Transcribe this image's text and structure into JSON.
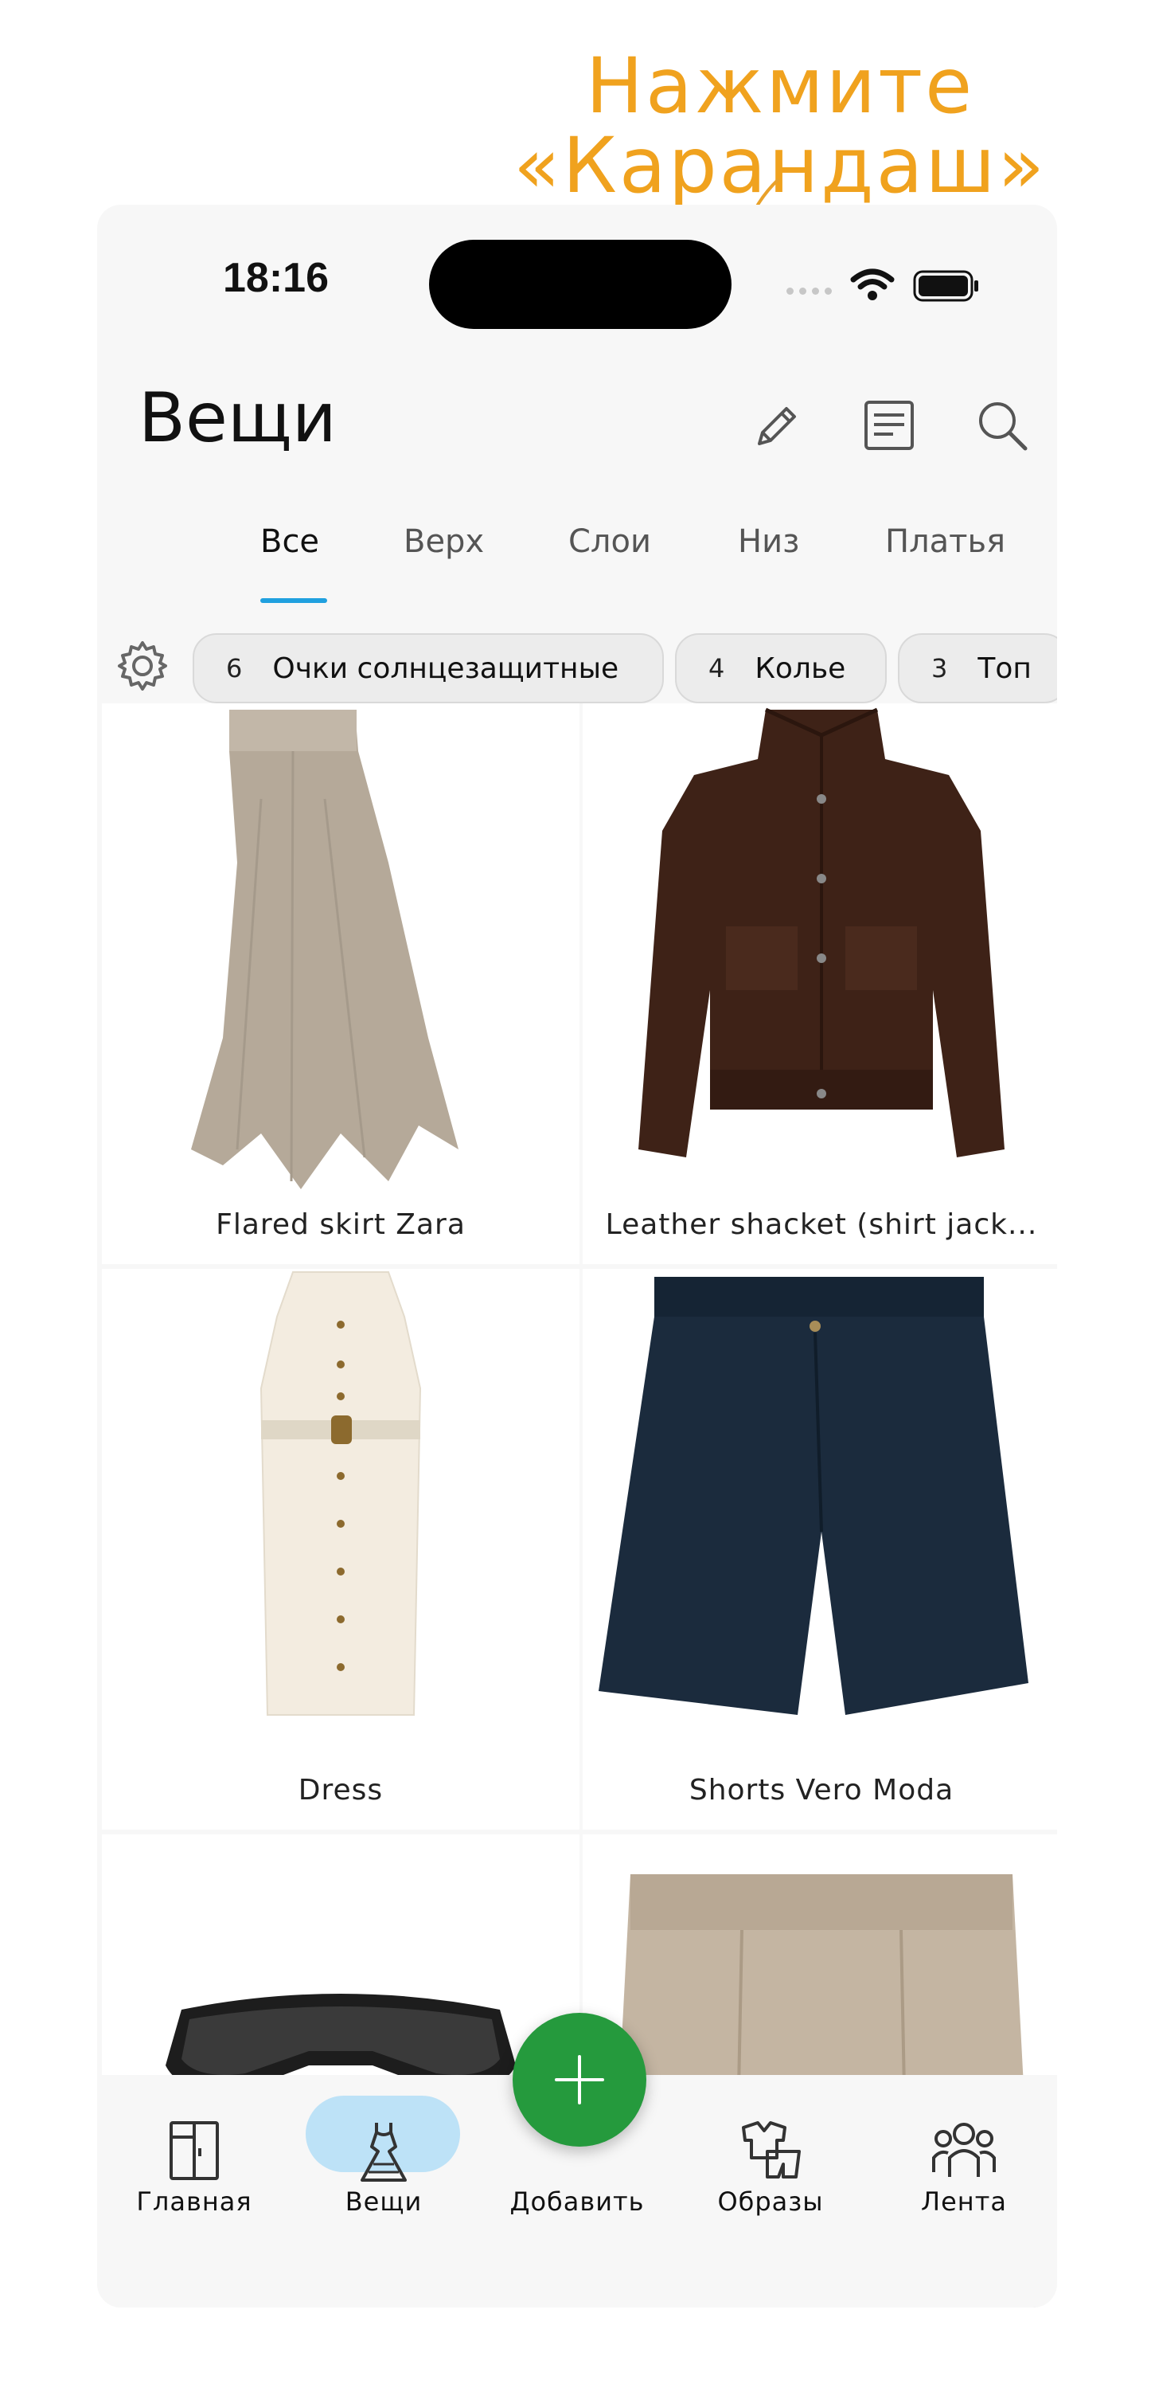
{
  "callout": {
    "line1": "Нажмите",
    "line2": "«Карандаш»"
  },
  "status_bar": {
    "time": "18:16"
  },
  "header": {
    "title": "Вещи",
    "icons": [
      "pencil-icon",
      "list-icon",
      "search-icon"
    ]
  },
  "tabs": [
    {
      "label": "Все",
      "active": true
    },
    {
      "label": "Верх",
      "active": false
    },
    {
      "label": "Слои",
      "active": false
    },
    {
      "label": "Низ",
      "active": false
    },
    {
      "label": "Платья",
      "active": false
    }
  ],
  "filter_chips": [
    {
      "count": "6",
      "label": "Очки солнцезащитные"
    },
    {
      "count": "4",
      "label": "Колье"
    },
    {
      "count": "3",
      "label": "Топ"
    }
  ],
  "items": [
    {
      "caption": "Flared skirt Zara"
    },
    {
      "caption": "Leather shacket (shirt jack..."
    },
    {
      "caption": "Dress"
    },
    {
      "caption": "Shorts Vero Moda"
    },
    {
      "caption": ""
    },
    {
      "caption": ""
    }
  ],
  "bottom_nav": [
    {
      "label": "Главная",
      "icon": "wardrobe-icon",
      "active": false
    },
    {
      "label": "Вещи",
      "icon": "dress-icon",
      "active": true
    },
    {
      "label": "Добавить",
      "icon": "plus-icon",
      "active": false
    },
    {
      "label": "Образы",
      "icon": "outfit-icon",
      "active": false
    },
    {
      "label": "Лента",
      "icon": "people-icon",
      "active": false
    }
  ],
  "colors": {
    "accent_callout": "#f0a21e",
    "tab_underline": "#20a0df",
    "fab": "#259a3d",
    "active_nav_pill": "#bde2f7"
  }
}
